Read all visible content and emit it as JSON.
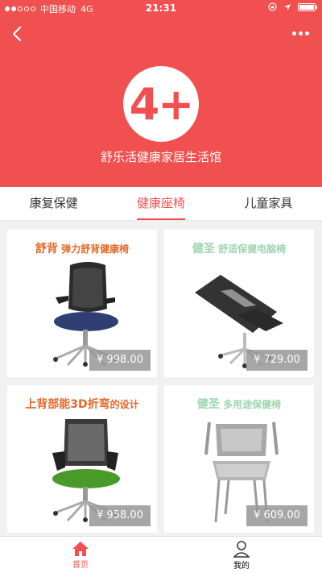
{
  "status_bar": {
    "carrier": "中国移动",
    "network": "4G",
    "time": "21:31",
    "signal_level": 0.4,
    "battery_level": 1.0
  },
  "header": {
    "logo_text": "4+",
    "store_name": "舒乐活健康家居生活馆",
    "back_icon": "chevron-left-icon",
    "more_icon": "more-icon",
    "accent_color": "#f0504f"
  },
  "tabs": [
    {
      "label": "康复保健",
      "active": false
    },
    {
      "label": "健康座椅",
      "active": true
    },
    {
      "label": "儿童家具",
      "active": false
    }
  ],
  "products": [
    {
      "caption_strong": "舒背",
      "caption": " 弹力舒背健康椅",
      "price": "¥ 998.00",
      "caption_color": "#e8682a"
    },
    {
      "caption_strong": "健圣",
      "caption": " 舒适保健电脑椅",
      "price": "¥ 729.00",
      "caption_color": "#9ed6b0"
    },
    {
      "caption_strong": "上背部能3D折弯",
      "caption": "的设计",
      "price": "¥ 958.00",
      "caption_color": "#e8682a"
    },
    {
      "caption_strong": "健圣",
      "caption": " 多用途保健椅",
      "price": "¥ 609.00",
      "caption_color": "#9ed6b0"
    }
  ],
  "bottom_nav": [
    {
      "label": "首页",
      "icon": "home-icon",
      "active": true
    },
    {
      "label": "我的",
      "icon": "user-icon",
      "active": false
    }
  ]
}
